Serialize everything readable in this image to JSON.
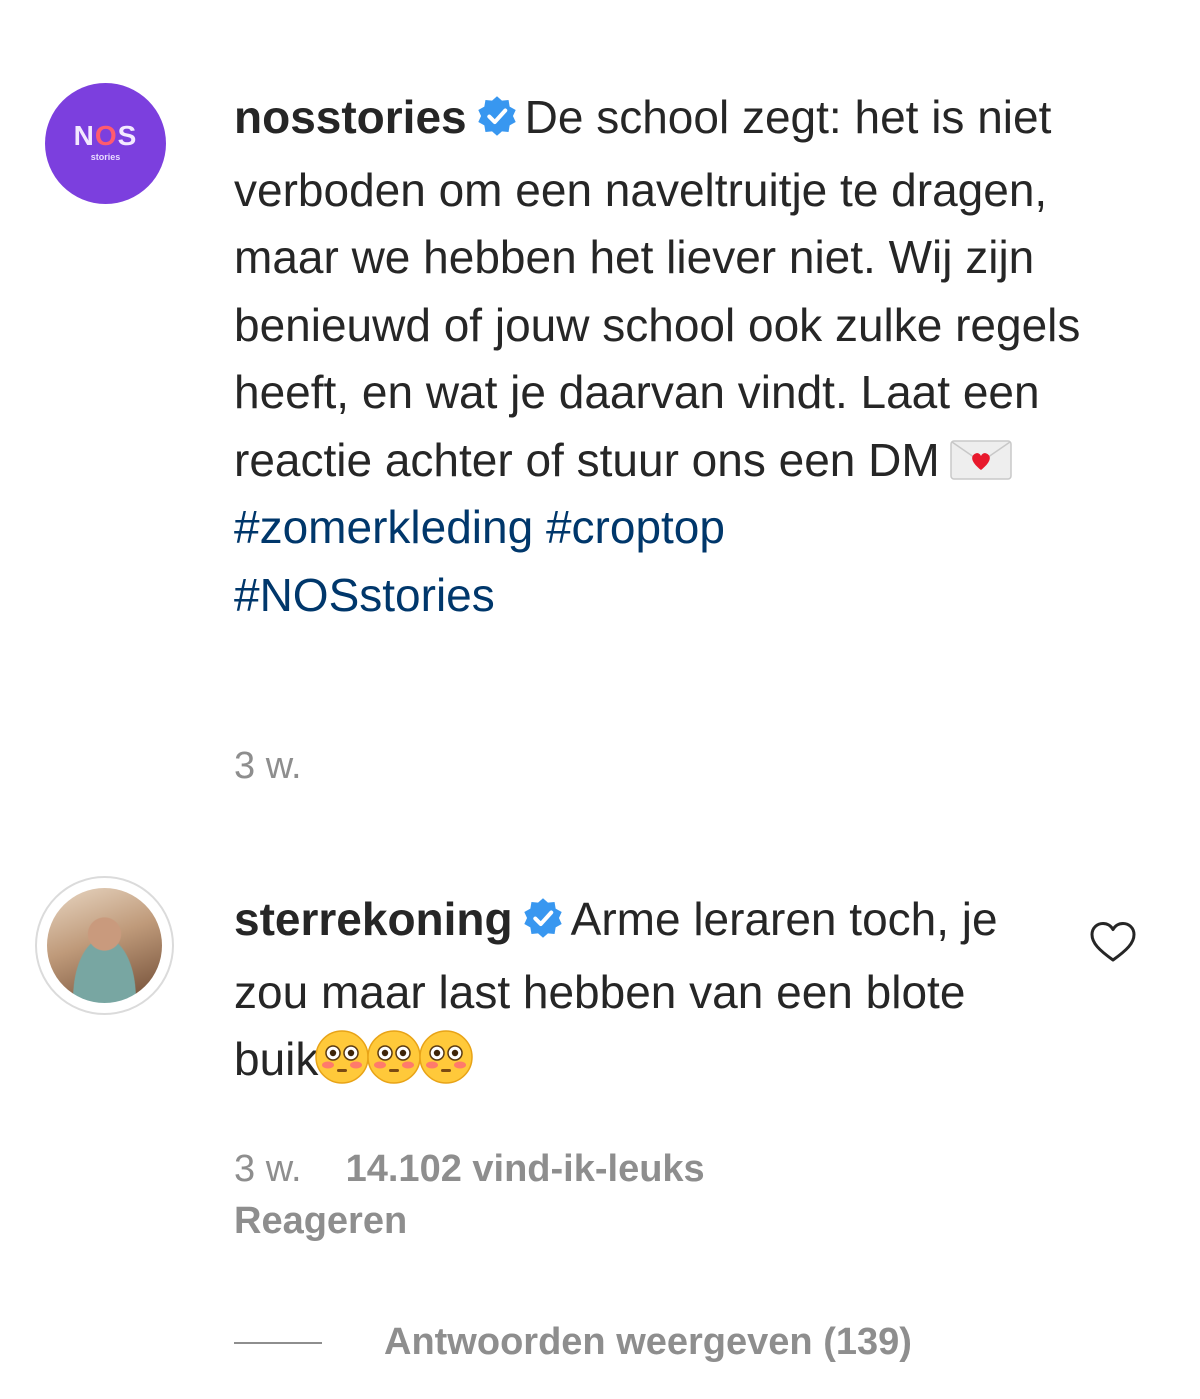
{
  "post": {
    "username": "nosstories",
    "avatar_logo": "NOS",
    "avatar_sub": "stories",
    "caption_text": "De school zegt: het is niet verboden om een naveltruitje te dragen, maar we hebben het liever niet. Wij zijn benieuwd of jouw school ook zulke regels heeft, en wat je daarvan vindt. Laat een reactie achter of stuur ons een DM",
    "caption_emoji": "love-letter-emoji",
    "hashtags": [
      "#zomerkleding",
      "#croptop",
      "#NOSstories"
    ],
    "time": "3 w."
  },
  "comment": {
    "username": "sterrekoning",
    "text": "Arme leraren toch, je zou maar last hebben van een blote buik",
    "emoji": "flushed-face-emoji x3",
    "time": "3 w.",
    "likes": "14.102 vind-ik-leuks",
    "reply_label": "Reageren",
    "view_replies_label": "Antwoorden weergeven (139)"
  },
  "icons": {
    "verified": "verified-badge-icon",
    "heart": "heart-outline-icon"
  },
  "colors": {
    "text": "#262626",
    "muted": "#8e8e8e",
    "hashtag": "#00376b",
    "verified": "#3897f0",
    "nos_avatar_bg": "#7c3fde"
  }
}
